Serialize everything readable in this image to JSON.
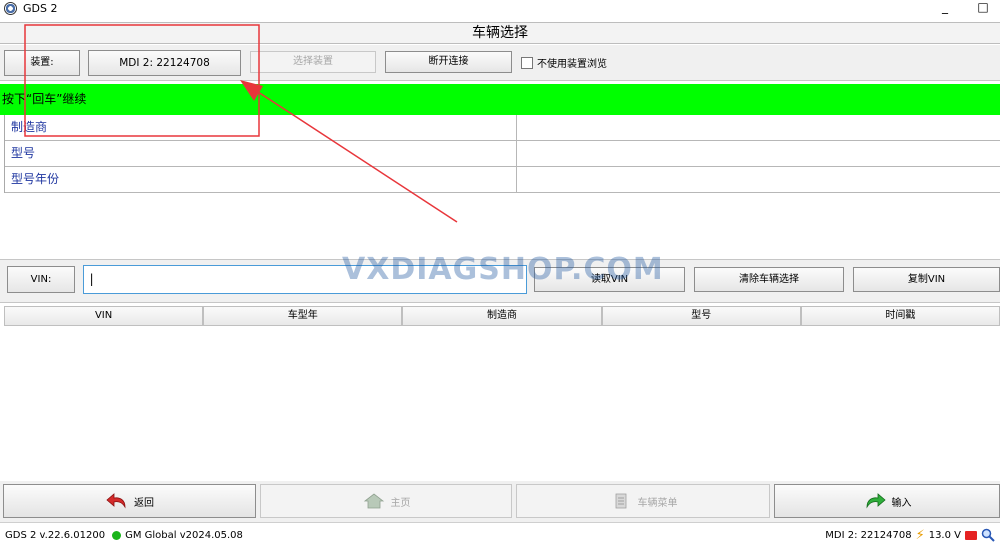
{
  "window": {
    "title": "GDS 2",
    "min": "_",
    "max": "□"
  },
  "header": {
    "title": "车辆选择"
  },
  "device": {
    "label": "装置:",
    "value": "MDI 2: 22124708",
    "select_button": "选择装置",
    "disconnect_button": "断开连接",
    "checkbox_label": "不使用装置浏览"
  },
  "banner": {
    "text": "按下“回车”继续"
  },
  "vehicle": {
    "rows": [
      {
        "label": "制造商",
        "value": ""
      },
      {
        "label": "型号",
        "value": ""
      },
      {
        "label": "型号年份",
        "value": ""
      }
    ]
  },
  "vin": {
    "label": "VIN:",
    "value": "|",
    "read_button": "读取VIN",
    "clear_button": "清除车辆选择",
    "copy_button": "复制VIN"
  },
  "list": {
    "columns": [
      "VIN",
      "车型年",
      "制造商",
      "型号",
      "时间戳"
    ]
  },
  "nav": {
    "back": "返回",
    "home": "主页",
    "menu": "车辆菜单",
    "input": "输入"
  },
  "status": {
    "version": "GDS 2 v.22.6.01200",
    "global": "GM Global v2024.05.08",
    "device": "MDI 2: 22124708",
    "voltage": "13.0 V"
  },
  "watermark": "VXDIAGSHOP.COM",
  "colors": {
    "banner": "#00ff00",
    "annotation": "#e8363b",
    "label_blue": "#1f36a0"
  }
}
